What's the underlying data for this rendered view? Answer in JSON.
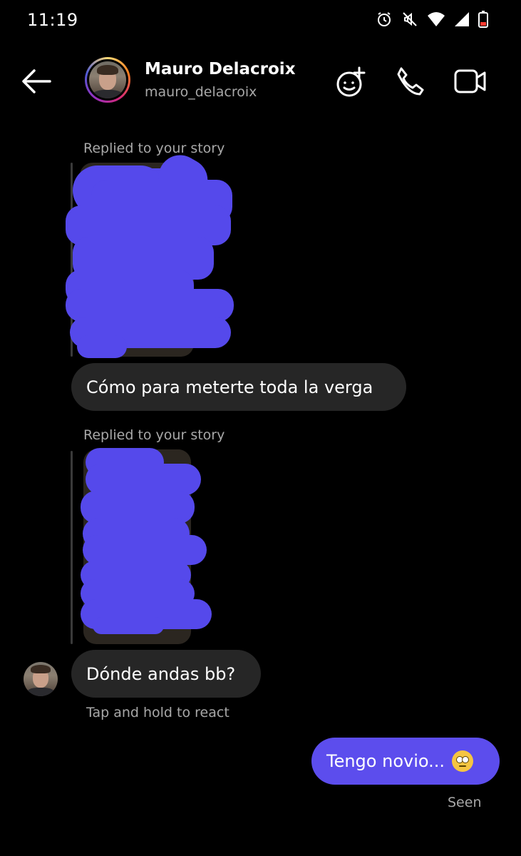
{
  "status_bar": {
    "time": "11:19",
    "icons": [
      "alarm-icon",
      "vibrate-off-icon",
      "wifi-icon",
      "signal-icon",
      "battery-icon"
    ]
  },
  "header": {
    "display_name": "Mauro Delacroix",
    "username": "mauro_delacroix",
    "actions": [
      "add-effect-icon",
      "phone-icon",
      "video-icon"
    ]
  },
  "messages": {
    "story_reply_1": {
      "label": "Replied to your story",
      "text": "Cómo para meterte toda la verga"
    },
    "story_reply_2": {
      "label": "Replied to your story"
    },
    "incoming_3": {
      "text": "Dónde andas bb?",
      "hint": "Tap and hold to react"
    },
    "outgoing_1": {
      "text": "Tengo novio...",
      "emoji": "eye-roll-emoji",
      "status": "Seen"
    }
  },
  "colors": {
    "background": "#000000",
    "incoming_bubble": "#262626",
    "outgoing_bubble": "#5c4ded",
    "redaction": "#5549eb",
    "secondary_text": "#a8a8a8"
  }
}
